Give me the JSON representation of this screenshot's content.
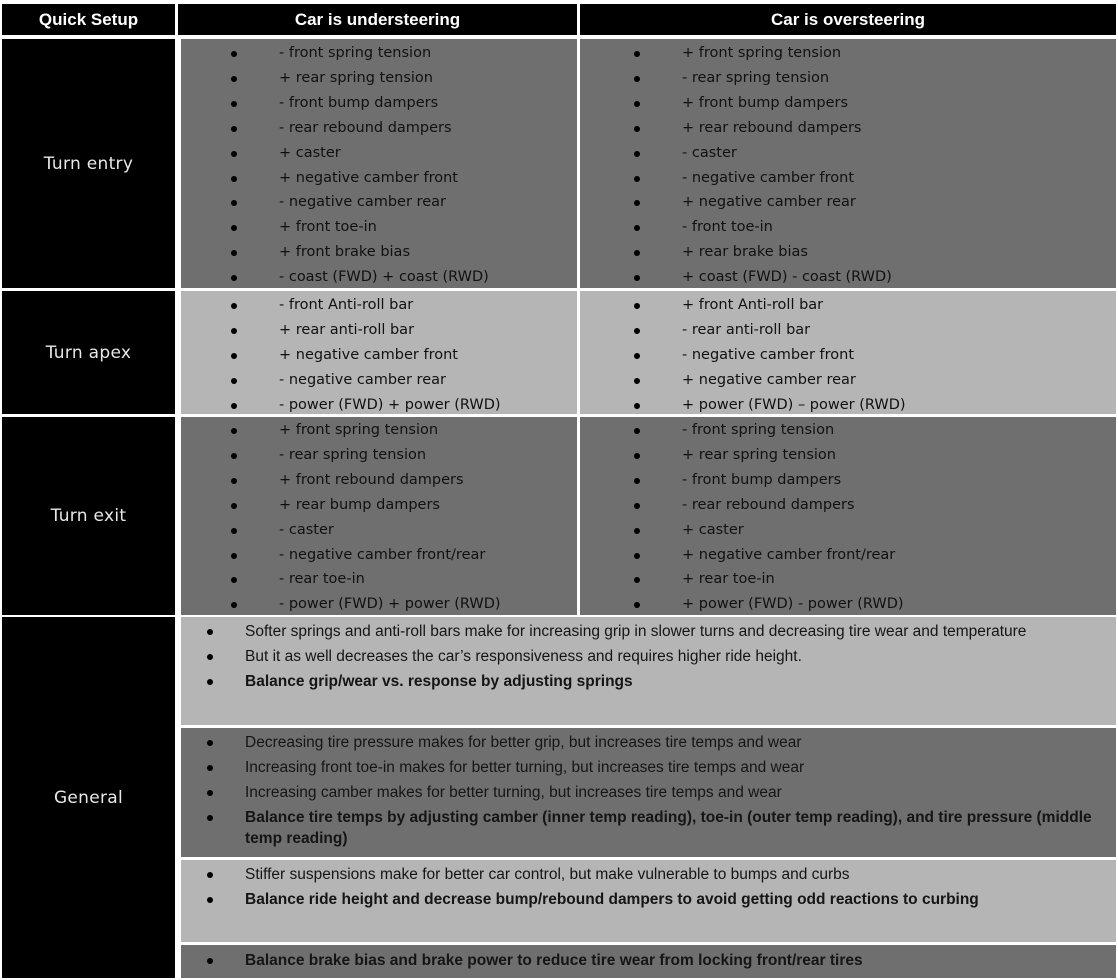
{
  "header": {
    "col0": "Quick Setup",
    "col1": "Car is understeering",
    "col2": "Car is oversteering"
  },
  "rows": [
    {
      "label": "Turn entry",
      "understeering": [
        "- front spring tension",
        "+ rear spring tension",
        "- front bump dampers",
        "- rear rebound dampers",
        "+ caster",
        "+ negative camber front",
        "- negative camber rear",
        "+ front toe-in",
        "+ front brake bias",
        "- coast (FWD) + coast (RWD)"
      ],
      "oversteering": [
        "+ front spring tension",
        "- rear spring tension",
        "+ front bump dampers",
        "+ rear rebound dampers",
        "- caster",
        "- negative camber front",
        "+ negative camber rear",
        "- front toe-in",
        "+ rear brake bias",
        "+ coast (FWD) - coast (RWD)"
      ]
    },
    {
      "label": "Turn apex",
      "understeering": [
        "- front Anti-roll bar",
        "+ rear anti-roll bar",
        "+ negative camber front",
        "- negative camber rear",
        "- power (FWD) + power (RWD)"
      ],
      "oversteering": [
        "+ front Anti-roll bar",
        "- rear anti-roll bar",
        "- negative camber front",
        "+ negative camber rear",
        "+ power (FWD) – power (RWD)"
      ]
    },
    {
      "label": "Turn exit",
      "understeering": [
        "+ front spring tension",
        "- rear spring tension",
        "+ front rebound dampers",
        "+ rear bump dampers",
        "- caster",
        "- negative camber front/rear",
        "- rear toe-in",
        "- power (FWD)  + power (RWD)"
      ],
      "oversteering": [
        "- front spring tension",
        "+ rear spring tension",
        "- front bump dampers",
        "- rear rebound dampers",
        "+ caster",
        "+ negative camber front/rear",
        "+ rear toe-in",
        "+ power (FWD) - power (RWD)"
      ]
    }
  ],
  "general": {
    "label": "General",
    "blocks": [
      {
        "items": [
          {
            "text": "Softer springs and anti-roll bars make for increasing grip in slower turns and decreasing tire wear and temperature",
            "bold": false
          },
          {
            "text": "But it as well decreases the car’s responsiveness and requires higher ride height.",
            "bold": false
          },
          {
            "text": "Balance grip/wear vs. response by adjusting springs",
            "bold": true
          }
        ]
      },
      {
        "items": [
          {
            "text": "Decreasing tire pressure makes for better grip, but increases tire temps and wear",
            "bold": false
          },
          {
            "text": "Increasing front toe-in makes for better turning, but increases tire temps and wear",
            "bold": false
          },
          {
            "text": "Increasing camber makes for better turning, but increases tire temps and wear",
            "bold": false
          },
          {
            "text": "Balance tire temps by adjusting camber (inner temp reading), toe-in (outer temp reading), and tire pressure (middle temp reading)",
            "bold": true
          }
        ]
      },
      {
        "items": [
          {
            "text": "Stiffer suspensions make for better car control, but make vulnerable to bumps and curbs",
            "bold": false
          },
          {
            "text": "Balance ride height and decrease bump/rebound dampers to avoid getting odd reactions to curbing",
            "bold": true
          }
        ]
      },
      {
        "items": [
          {
            "text": "Balance brake bias and brake power to reduce tire wear from locking front/rear tires",
            "bold": true
          }
        ]
      }
    ]
  },
  "colors": {
    "header_bg": "#000000",
    "label_bg": "#000000",
    "cell_dark": "#6f6f6f",
    "cell_light": "#b5b5b5"
  }
}
